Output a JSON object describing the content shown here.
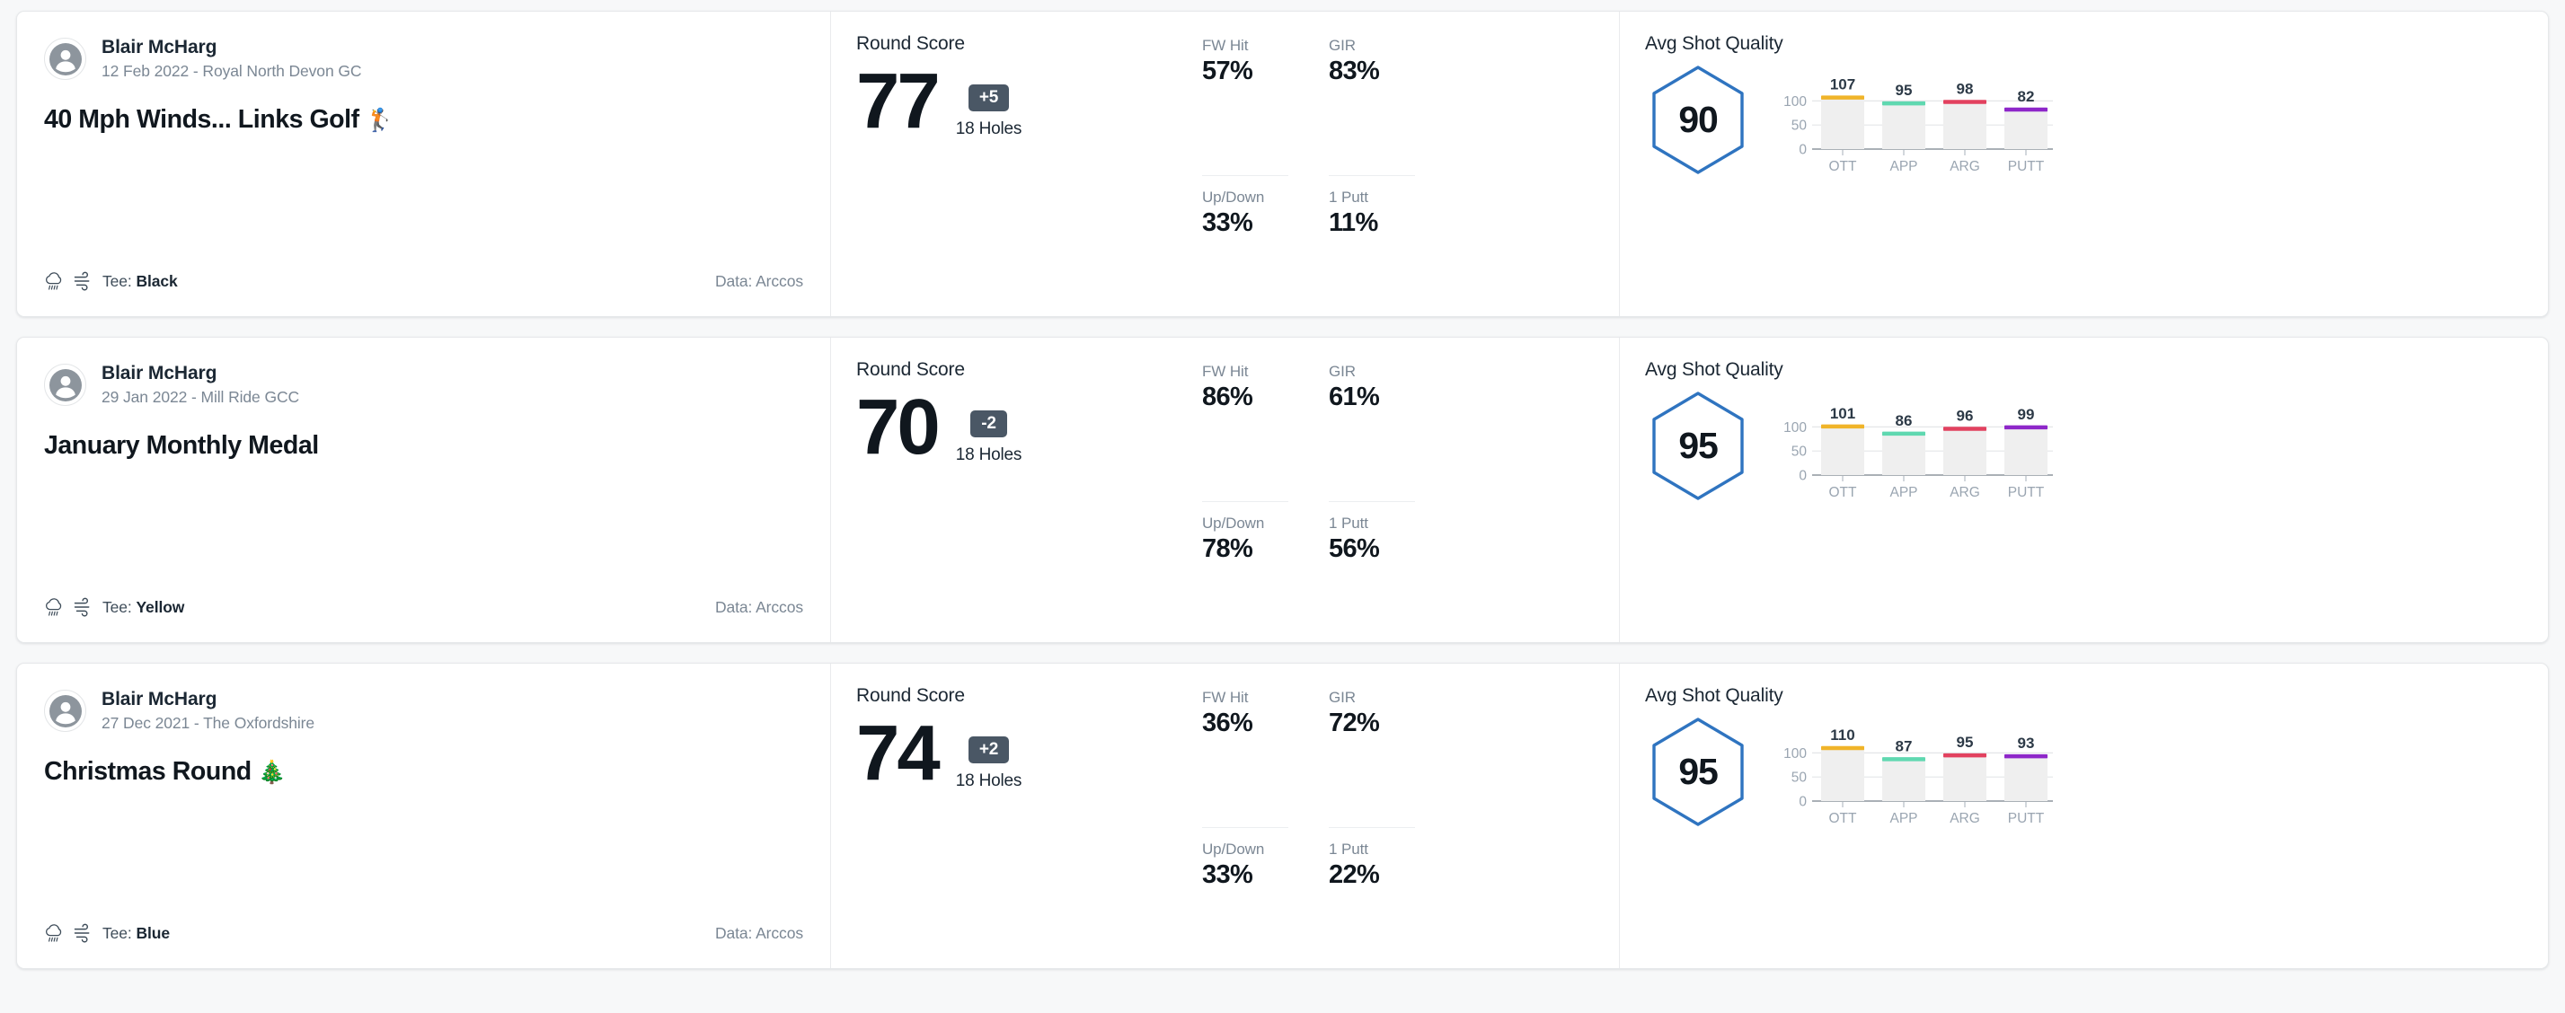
{
  "labels": {
    "round_score_heading": "Round Score",
    "holes": "18 Holes",
    "shot_quality_heading": "Avg Shot Quality",
    "tee_prefix": "Tee: ",
    "data_prefix": "Data: "
  },
  "colors": {
    "ott": "#f0b429",
    "app": "#5fd8b0",
    "arg": "#e2415f",
    "putt": "#8e27c9",
    "hexagon": "#2f74c0",
    "badge": "#4a5765",
    "bar_track": "#efefef",
    "gridline": "#e4e6e8",
    "axis": "#9aa5b1"
  },
  "chart_axis": {
    "yticks": [
      100,
      50,
      0
    ],
    "ylim": [
      0,
      125
    ],
    "categories": [
      "OTT",
      "APP",
      "ARG",
      "PUTT"
    ]
  },
  "rounds": [
    {
      "player": "Blair McHarg",
      "meta": "12 Feb 2022 - Royal North Devon GC",
      "title": "40 Mph Winds... Links Golf",
      "title_emoji": "🏌️",
      "tee": "Black",
      "data_source": "Arccos",
      "weather_icons": [
        "rain-cloud-icon",
        "wind-icon"
      ],
      "score": "77",
      "diff": "+5",
      "holes": "18 Holes",
      "stats": [
        {
          "label": "FW Hit",
          "value": "57%"
        },
        {
          "label": "GIR",
          "value": "83%"
        },
        {
          "label": "Up/Down",
          "value": "33%"
        },
        {
          "label": "1 Putt",
          "value": "11%"
        }
      ],
      "shot_quality": "90",
      "chart_data": {
        "type": "bar",
        "title": "Avg Shot Quality",
        "categories": [
          "OTT",
          "APP",
          "ARG",
          "PUTT"
        ],
        "values": [
          107,
          95,
          98,
          82
        ],
        "ylim": [
          0,
          125
        ],
        "yticks": [
          0,
          50,
          100
        ],
        "xlabel": "",
        "ylabel": "",
        "grid": true,
        "legend": "none"
      }
    },
    {
      "player": "Blair McHarg",
      "meta": "29 Jan 2022 - Mill Ride GCC",
      "title": "January Monthly Medal",
      "title_emoji": "",
      "tee": "Yellow",
      "data_source": "Arccos",
      "weather_icons": [
        "rain-cloud-icon",
        "wind-icon"
      ],
      "score": "70",
      "diff": "-2",
      "holes": "18 Holes",
      "stats": [
        {
          "label": "FW Hit",
          "value": "86%"
        },
        {
          "label": "GIR",
          "value": "61%"
        },
        {
          "label": "Up/Down",
          "value": "78%"
        },
        {
          "label": "1 Putt",
          "value": "56%"
        }
      ],
      "shot_quality": "95",
      "chart_data": {
        "type": "bar",
        "title": "Avg Shot Quality",
        "categories": [
          "OTT",
          "APP",
          "ARG",
          "PUTT"
        ],
        "values": [
          101,
          86,
          96,
          99
        ],
        "ylim": [
          0,
          125
        ],
        "yticks": [
          0,
          50,
          100
        ],
        "xlabel": "",
        "ylabel": "",
        "grid": true,
        "legend": "none"
      }
    },
    {
      "player": "Blair McHarg",
      "meta": "27 Dec 2021 - The Oxfordshire",
      "title": "Christmas Round",
      "title_emoji": "🎄",
      "tee": "Blue",
      "data_source": "Arccos",
      "weather_icons": [
        "rain-cloud-icon",
        "wind-icon"
      ],
      "score": "74",
      "diff": "+2",
      "holes": "18 Holes",
      "stats": [
        {
          "label": "FW Hit",
          "value": "36%"
        },
        {
          "label": "GIR",
          "value": "72%"
        },
        {
          "label": "Up/Down",
          "value": "33%"
        },
        {
          "label": "1 Putt",
          "value": "22%"
        }
      ],
      "shot_quality": "95",
      "chart_data": {
        "type": "bar",
        "title": "Avg Shot Quality",
        "categories": [
          "OTT",
          "APP",
          "ARG",
          "PUTT"
        ],
        "values": [
          110,
          87,
          95,
          93
        ],
        "ylim": [
          0,
          125
        ],
        "yticks": [
          0,
          50,
          100
        ],
        "xlabel": "",
        "ylabel": "",
        "grid": true,
        "legend": "none"
      }
    }
  ]
}
